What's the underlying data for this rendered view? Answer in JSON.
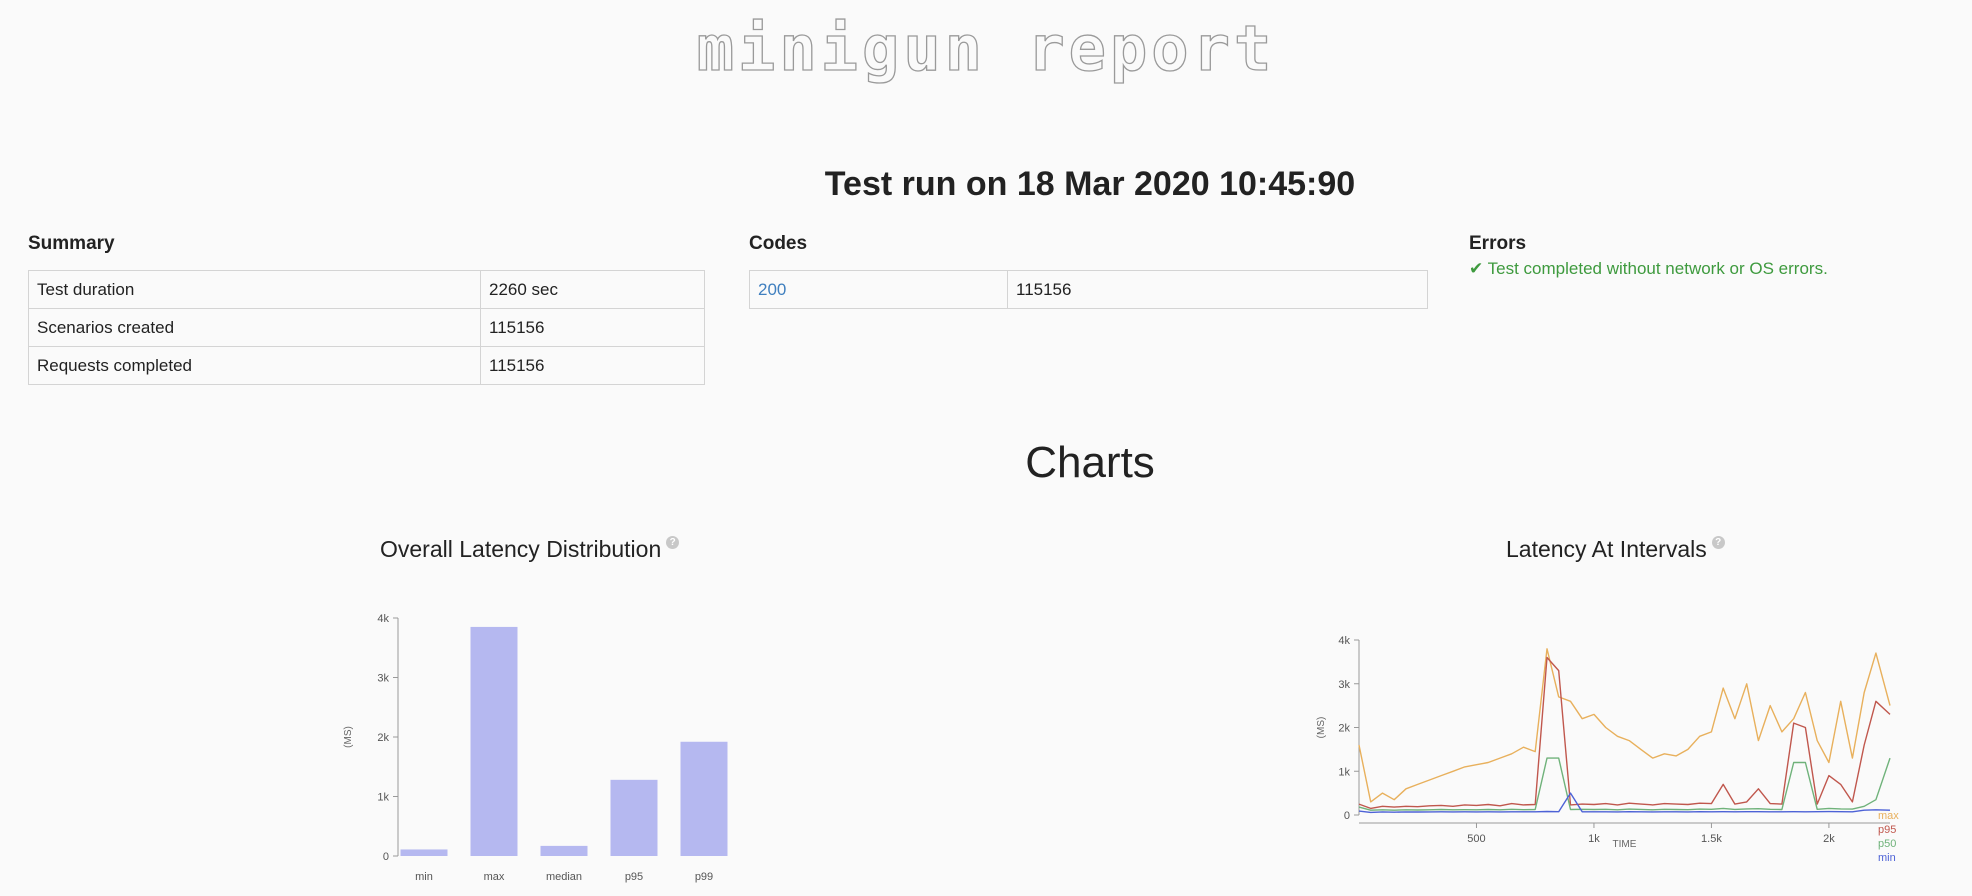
{
  "header": {
    "logo_text": "minigun report",
    "run_title": "Test run on 18 Mar 2020 10:45:90"
  },
  "summary": {
    "label": "Summary",
    "rows": [
      {
        "name": "Test duration",
        "value": "2260 sec"
      },
      {
        "name": "Scenarios created",
        "value": "115156"
      },
      {
        "name": "Requests completed",
        "value": "115156"
      }
    ]
  },
  "codes": {
    "label": "Codes",
    "rows": [
      {
        "code": "200",
        "count": "115156"
      }
    ]
  },
  "errors": {
    "label": "Errors",
    "message": "✔ Test completed without network or OS errors.",
    "color": "#3e9a3e"
  },
  "charts_heading": "Charts",
  "help_icon": "question-mark-icon",
  "chart_data": [
    {
      "type": "bar",
      "title": "Overall Latency Distribution",
      "ylabel": "(MS)",
      "xlabel": "",
      "categories": [
        "min",
        "max",
        "median",
        "p95",
        "p99"
      ],
      "values": [
        110,
        3850,
        170,
        1280,
        1920
      ],
      "ylim": [
        0,
        4000
      ],
      "yticks": [
        0,
        1000,
        2000,
        3000,
        4000
      ],
      "ytick_labels": [
        "0",
        "1k",
        "2k",
        "3k",
        "4k"
      ],
      "bar_color": "#b5b8f0",
      "grid": false,
      "legend": "none"
    },
    {
      "type": "line",
      "title": "Latency At Intervals",
      "ylabel": "(MS)",
      "xlabel": "TIME",
      "xlim": [
        0,
        2260
      ],
      "ylim": [
        0,
        4000
      ],
      "xticks": [
        500,
        1000,
        1500,
        2000
      ],
      "xtick_labels": [
        "500",
        "1k",
        "1.5k",
        "2k"
      ],
      "yticks": [
        0,
        1000,
        2000,
        3000,
        4000
      ],
      "ytick_labels": [
        "0",
        "1k",
        "2k",
        "3k",
        "4k"
      ],
      "grid": false,
      "legend": "bottom-right",
      "x": [
        0,
        50,
        100,
        150,
        200,
        250,
        300,
        350,
        400,
        450,
        500,
        550,
        600,
        650,
        700,
        750,
        800,
        850,
        900,
        950,
        1000,
        1050,
        1100,
        1150,
        1200,
        1250,
        1300,
        1350,
        1400,
        1450,
        1500,
        1550,
        1600,
        1650,
        1700,
        1750,
        1800,
        1850,
        1900,
        1950,
        2000,
        2050,
        2100,
        2150,
        2200,
        2260
      ],
      "series": [
        {
          "name": "max",
          "color": "#e8b05c",
          "values": [
            1600,
            300,
            500,
            350,
            600,
            700,
            800,
            900,
            1000,
            1100,
            1150,
            1200,
            1300,
            1400,
            1550,
            1450,
            3800,
            2700,
            2600,
            2200,
            2300,
            2000,
            1800,
            1700,
            1500,
            1300,
            1400,
            1350,
            1500,
            1800,
            1900,
            2900,
            2200,
            3000,
            1700,
            2500,
            1900,
            2200,
            2800,
            1700,
            1200,
            2600,
            1300,
            2800,
            3700,
            2500
          ]
        },
        {
          "name": "p95",
          "color": "#c0574d",
          "values": [
            250,
            150,
            200,
            180,
            200,
            190,
            210,
            220,
            200,
            230,
            220,
            240,
            210,
            260,
            230,
            240,
            3600,
            3300,
            230,
            250,
            240,
            260,
            230,
            270,
            250,
            230,
            260,
            250,
            240,
            270,
            260,
            700,
            250,
            300,
            600,
            260,
            250,
            2100,
            2000,
            250,
            900,
            700,
            300,
            1600,
            2600,
            2300
          ]
        },
        {
          "name": "p50",
          "color": "#6fb27a",
          "values": [
            180,
            110,
            120,
            110,
            120,
            115,
            120,
            125,
            118,
            122,
            120,
            125,
            118,
            130,
            122,
            125,
            1300,
            1300,
            125,
            130,
            125,
            130,
            120,
            135,
            128,
            120,
            130,
            125,
            122,
            135,
            130,
            150,
            128,
            140,
            145,
            130,
            125,
            1200,
            1200,
            130,
            150,
            140,
            135,
            200,
            350,
            1300
          ]
        },
        {
          "name": "min",
          "color": "#4d62d6",
          "values": [
            90,
            60,
            70,
            65,
            70,
            68,
            70,
            72,
            70,
            72,
            70,
            72,
            70,
            74,
            72,
            72,
            80,
            75,
            500,
            72,
            74,
            72,
            70,
            76,
            74,
            70,
            74,
            72,
            70,
            76,
            74,
            75,
            72,
            76,
            75,
            74,
            72,
            75,
            74,
            76,
            78,
            76,
            74,
            110,
            120,
            110
          ]
        }
      ]
    }
  ]
}
